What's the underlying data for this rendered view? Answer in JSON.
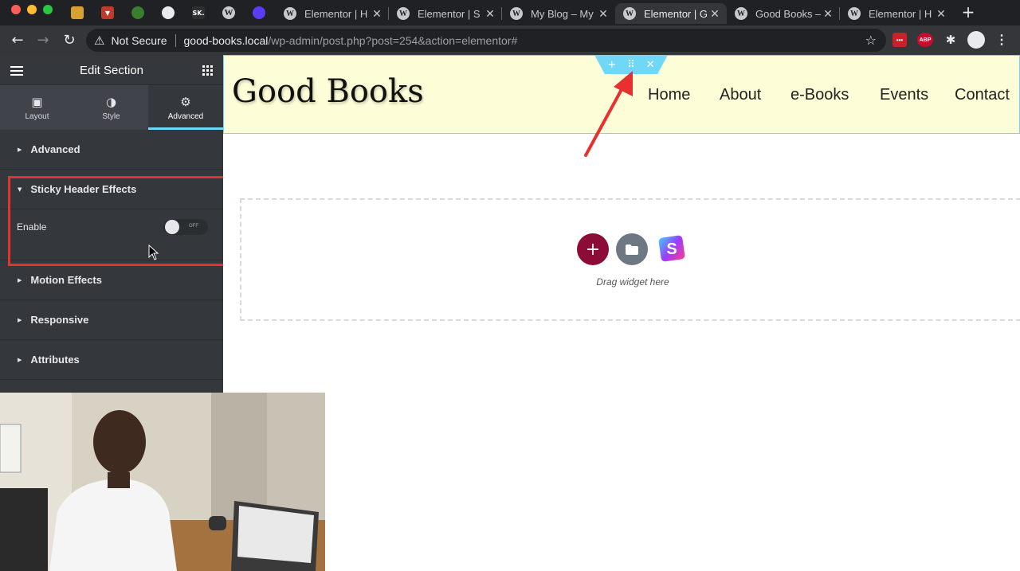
{
  "browser": {
    "pinned_tabs": [
      {
        "icon": "notes-icon",
        "color": "#d8a030"
      },
      {
        "icon": "todoist-icon",
        "color": "#c0392b"
      },
      {
        "icon": "green-app-icon",
        "color": "#3a7d2c"
      },
      {
        "icon": "teal-app-icon",
        "color": "#3c4043"
      },
      {
        "icon": "sk-icon",
        "color": "#2d2f31",
        "text": "SK."
      },
      {
        "icon": "wordpress-icon",
        "color": "#c7c9cc"
      },
      {
        "icon": "circle-app-icon",
        "color": "#5b3df5"
      }
    ],
    "tabs": [
      {
        "title": "Elementor | H",
        "active": false
      },
      {
        "title": "Elementor | S",
        "active": false
      },
      {
        "title": "My Blog – My",
        "active": false
      },
      {
        "title": "Elementor | G",
        "active": true
      },
      {
        "title": "Good Books –",
        "active": false
      },
      {
        "title": "Elementor | H",
        "active": false
      }
    ],
    "security_label": "Not Secure",
    "url_host": "good-books.local",
    "url_path": "/wp-admin/post.php?post=254&action=elementor#",
    "extensions": [
      {
        "name": "lastpass-extension",
        "label": "•••",
        "color": "#cc2029"
      },
      {
        "name": "adblock-extension",
        "label": "ABP",
        "color": "#c70d2c"
      },
      {
        "name": "puzzle-extension",
        "label": "",
        "color": "#e8eaed"
      },
      {
        "name": "profile-avatar",
        "label": "",
        "color": "#e8eaed"
      },
      {
        "name": "menu-extension",
        "label": "",
        "color": "#e8eaed"
      }
    ]
  },
  "panel": {
    "title": "Edit Section",
    "tabs": [
      {
        "label": "Layout",
        "icon": "layout-icon"
      },
      {
        "label": "Style",
        "icon": "style-icon"
      },
      {
        "label": "Advanced",
        "icon": "gear-icon",
        "active": true
      }
    ],
    "sections": {
      "advanced": "Advanced",
      "sticky": "Sticky Header Effects",
      "motion": "Motion Effects",
      "responsive": "Responsive",
      "attributes": "Attributes"
    },
    "enable_label": "Enable",
    "toggle_state": "OFF",
    "accent_color": "#71d7f7",
    "highlight_color": "#e8302f"
  },
  "site": {
    "title": "Good Books",
    "nav": [
      "Home",
      "About",
      "e-Books",
      "Events",
      "Contact"
    ],
    "header_bg": "#fdfdd7"
  },
  "dropzone": {
    "label": "Drag widget here",
    "add_color": "#8b0c36",
    "folder_color": "#6d7882"
  }
}
